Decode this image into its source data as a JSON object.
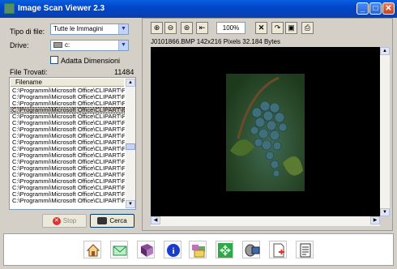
{
  "window": {
    "title": "Image Scan Viewer 2.3"
  },
  "left_panel": {
    "file_type_label": "Tipo di file:",
    "file_type_value": "Tutte le Immagini",
    "drive_label": "Drive:",
    "drive_value": "c:",
    "fit_label": "Adatta Dimensioni",
    "fit_checked": false,
    "files_found_label": "File Trovati:",
    "files_found_count": "11484",
    "list_header": "Filename",
    "rows": [
      "C:\\Programmi\\Microsoft Office\\CLIPART\\P",
      "C:\\Programmi\\Microsoft Office\\CLIPART\\P",
      "C:\\Programmi\\Microsoft Office\\CLIPART\\P",
      "C:\\Programmi\\Microsoft Office\\CLIPART\\P",
      "C:\\Programmi\\Microsoft Office\\CLIPART\\P",
      "C:\\Programmi\\Microsoft Office\\CLIPART\\P",
      "C:\\Programmi\\Microsoft Office\\CLIPART\\P",
      "C:\\Programmi\\Microsoft Office\\CLIPART\\P",
      "C:\\Programmi\\Microsoft Office\\CLIPART\\P",
      "C:\\Programmi\\Microsoft Office\\CLIPART\\P",
      "C:\\Programmi\\Microsoft Office\\CLIPART\\P",
      "C:\\Programmi\\Microsoft Office\\CLIPART\\P",
      "C:\\Programmi\\Microsoft Office\\CLIPART\\P",
      "C:\\Programmi\\Microsoft Office\\CLIPART\\P",
      "C:\\Programmi\\Microsoft Office\\CLIPART\\P",
      "C:\\Programmi\\Microsoft Office\\CLIPART\\P",
      "C:\\Programmi\\Microsoft Office\\CLIPART\\P",
      "C:\\Programmi\\Microsoft Office\\CLIPART\\P"
    ],
    "selected_row": 3,
    "stop_label": "Stop",
    "search_label": "Cerca"
  },
  "viewer": {
    "zoom": "100%",
    "file_info": "J0101866.BMP 142x216 Pixels 32.184 Bytes"
  },
  "colors": {
    "title_bar": "#0a5fe0",
    "canvas": "#000000",
    "window_bg": "#d4d0c8"
  }
}
